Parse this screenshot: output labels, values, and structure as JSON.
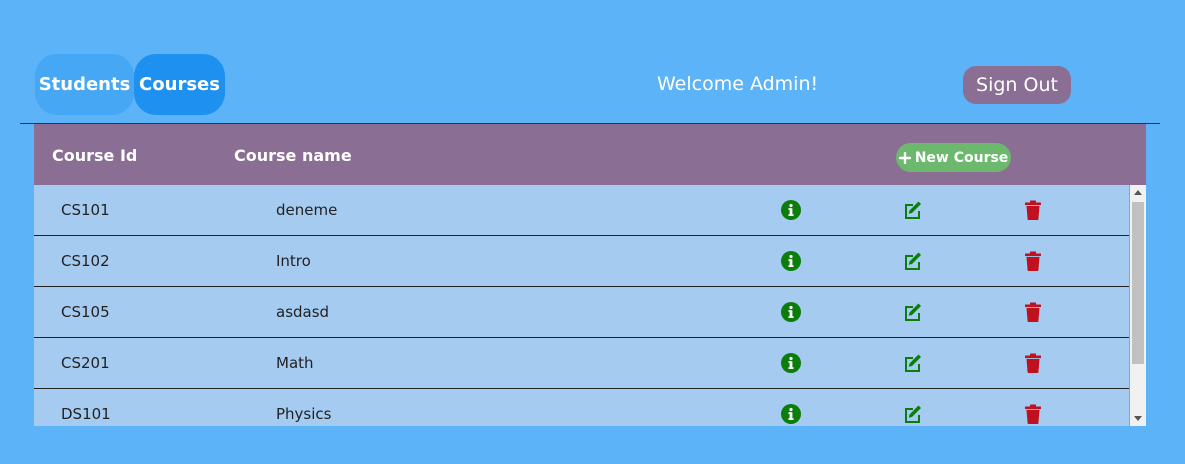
{
  "nav": {
    "students_label": "Students",
    "courses_label": "Courses"
  },
  "header": {
    "welcome": "Welcome Admin!",
    "signout_label": "Sign Out"
  },
  "table": {
    "headers": {
      "course_id": "Course Id",
      "course_name": "Course name"
    },
    "new_course_label": "New Course",
    "rows": [
      {
        "id": "CS101",
        "name": "deneme"
      },
      {
        "id": "CS102",
        "name": "Intro"
      },
      {
        "id": "CS105",
        "name": "asdasd"
      },
      {
        "id": "CS201",
        "name": "Math"
      },
      {
        "id": "DS101",
        "name": "Physics"
      }
    ]
  },
  "icons": {
    "info": "info-icon",
    "edit": "edit-icon",
    "delete": "trash-icon",
    "add": "plus-icon"
  },
  "colors": {
    "info": "#0a7d0a",
    "edit": "#0a7d0a",
    "delete": "#c0111f",
    "header": "#8a6e93",
    "accent": "#1e90f0"
  }
}
